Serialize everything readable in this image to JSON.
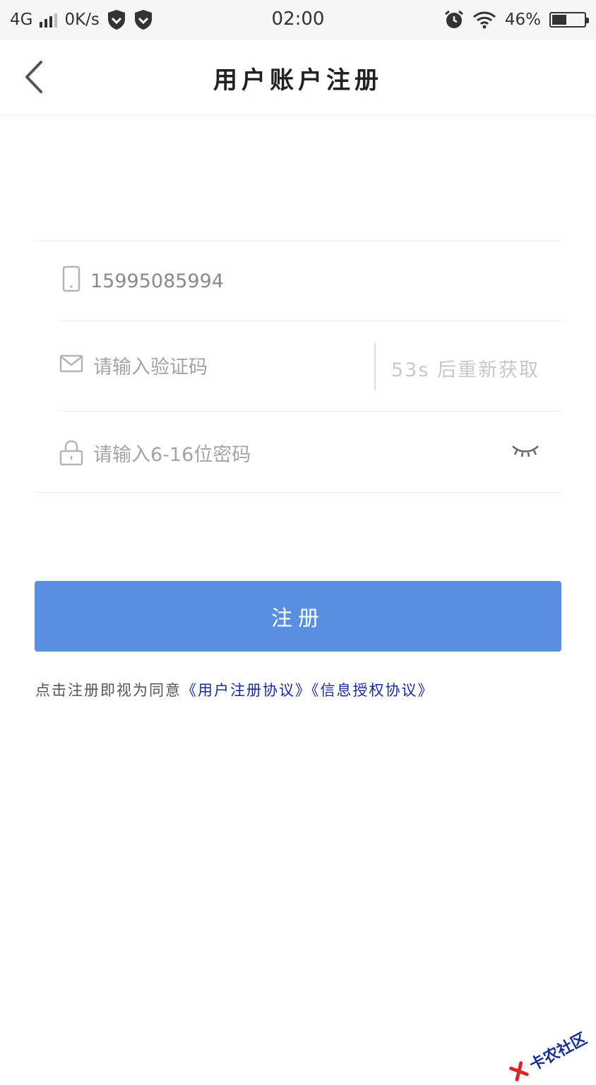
{
  "status_bar": {
    "network": "4G",
    "speed": "0K/s",
    "time": "02:00",
    "battery": "46%",
    "battery_level": 0.46
  },
  "nav": {
    "title": "用户账户注册"
  },
  "form": {
    "phone_value": "15995085994",
    "code_placeholder": "请输入验证码",
    "resend_label": "53s 后重新获取",
    "password_placeholder": "请输入6-16位密码"
  },
  "submit_label": "注册",
  "agreement": {
    "prefix": "点击注册即视为同意",
    "link1": "《用户注册协议》",
    "link2": "《信息授权协议》"
  },
  "watermark": {
    "text": "卡农社区",
    "color": "#1a2f8a"
  },
  "colors": {
    "primary": "#5a8fe0",
    "link": "#1c2a9a"
  }
}
